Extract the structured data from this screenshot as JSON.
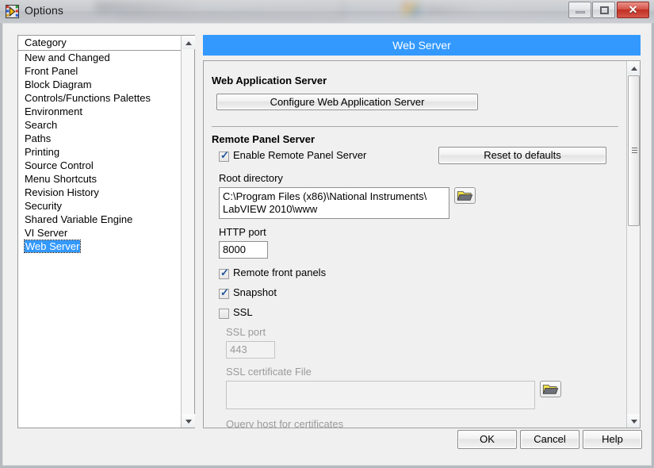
{
  "window": {
    "title": "Options",
    "icon": "labview-icon",
    "controls": {
      "minimize": "–",
      "maximize": "□",
      "close": "✕"
    }
  },
  "category": {
    "header": "Category",
    "items": [
      "New and Changed",
      "Front Panel",
      "Block Diagram",
      "Controls/Functions Palettes",
      "Environment",
      "Search",
      "Paths",
      "Printing",
      "Source Control",
      "Menu Shortcuts",
      "Revision History",
      "Security",
      "Shared Variable Engine",
      "VI Server",
      "Web Server"
    ],
    "selected": "Web Server",
    "selected_index": 14
  },
  "panel": {
    "title": "Web Server",
    "title_bg": "#3399ff",
    "sections": {
      "web_app_server": {
        "heading": "Web Application Server",
        "configure_button": "Configure Web Application Server"
      },
      "remote_panel_server": {
        "heading": "Remote Panel Server",
        "enable_checkbox": {
          "label": "Enable Remote Panel Server",
          "checked": true
        },
        "reset_button": "Reset to defaults",
        "root_directory": {
          "label": "Root directory",
          "value_line1": "C:\\Program Files (x86)\\National Instruments\\",
          "value_line2": "LabVIEW 2010\\www",
          "browse_icon": "folder-open-icon"
        },
        "http_port": {
          "label": "HTTP port",
          "value": "8000"
        },
        "remote_front_panels": {
          "label": "Remote front panels",
          "checked": true
        },
        "snapshot": {
          "label": "Snapshot",
          "checked": true
        },
        "ssl": {
          "label": "SSL",
          "checked": false
        },
        "ssl_port": {
          "label": "SSL port",
          "value": "443",
          "disabled": true
        },
        "ssl_certificate_file": {
          "label": "SSL certificate File",
          "value": "",
          "disabled": true,
          "browse_icon": "folder-open-icon"
        },
        "query_host": {
          "label": "Query host for certificates"
        }
      }
    }
  },
  "footer": {
    "ok": "OK",
    "cancel": "Cancel",
    "help": "Help"
  }
}
